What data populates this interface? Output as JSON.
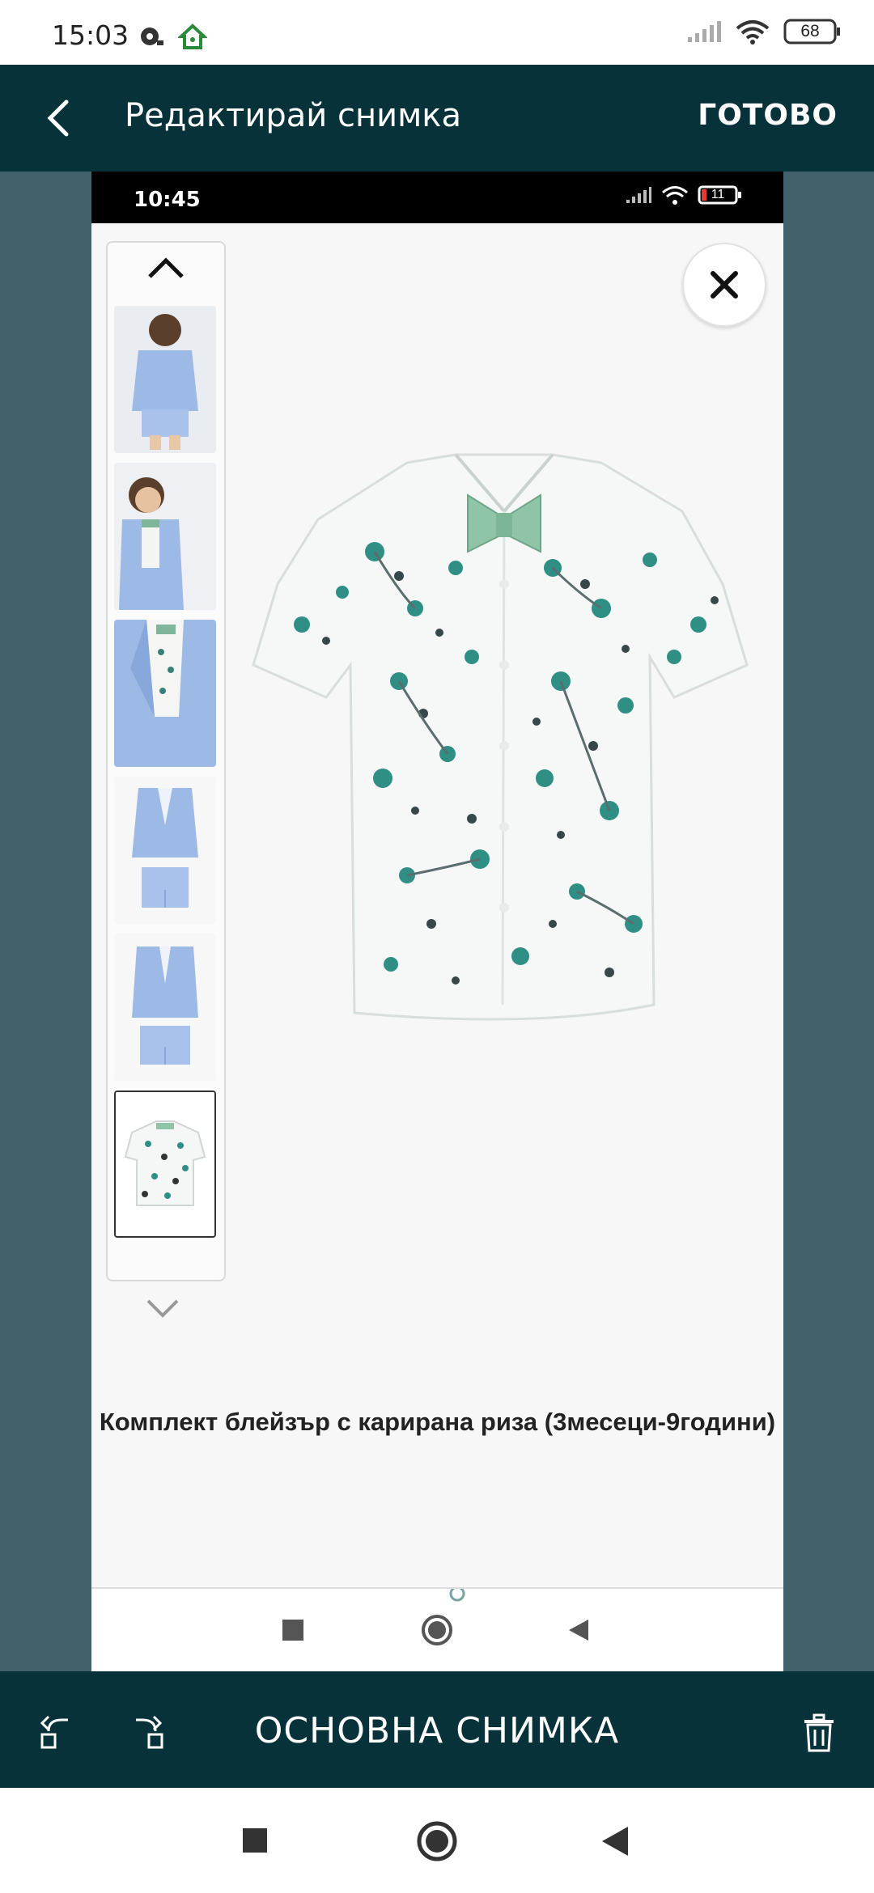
{
  "status_bar": {
    "time": "15:03",
    "battery": "68",
    "icons": [
      "notification-icon",
      "home-icon",
      "signal-icon",
      "wifi-icon",
      "battery-icon"
    ]
  },
  "app_bar": {
    "title": "Редактирай снимка",
    "done_label": "ГОТОВО",
    "back_icon": "chevron-left-icon"
  },
  "photo": {
    "inner_status": {
      "time": "10:45",
      "battery": "11"
    },
    "thumbnails": [
      {
        "name": "boy-back-suit"
      },
      {
        "name": "boy-front-suit"
      },
      {
        "name": "blazer-detail"
      },
      {
        "name": "suit-flat"
      },
      {
        "name": "suit-flat-2"
      },
      {
        "name": "floral-shirt",
        "selected": true
      }
    ],
    "product_title": "Комплект блейзър с карирана риза (3месеци-9години)"
  },
  "bottom_toolbar": {
    "main_photo_label": "ОСНОВНА СНИМКА",
    "icons": [
      "rotate-left-icon",
      "rotate-right-icon",
      "trash-icon"
    ]
  },
  "colors": {
    "app_bar_bg": "#08323a",
    "editor_bg": "#41626a",
    "shirt_print": "#2f8f85",
    "bow_tie": "#8fc4a8",
    "suit_blue": "#9db9e6"
  }
}
